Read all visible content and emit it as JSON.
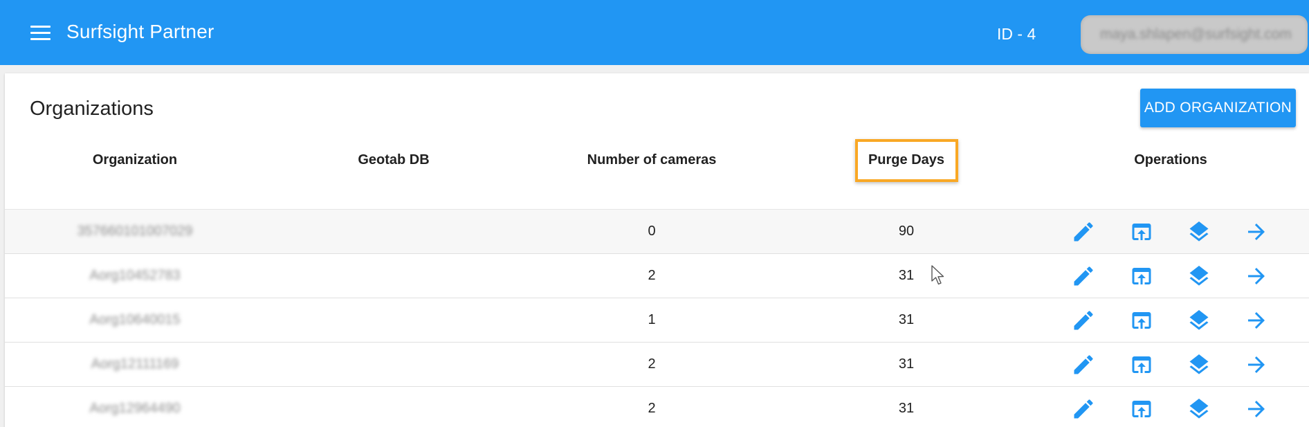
{
  "app": {
    "title": "Surfsight Partner",
    "id_label": "ID - 4",
    "user_email": "maya.shlapen@surfsight.com",
    "primary_color": "#2196f3",
    "highlight_color": "#f9a825"
  },
  "page": {
    "title": "Organizations",
    "add_button_label": "ADD ORGANIZATION"
  },
  "table": {
    "columns": {
      "organization": "Organization",
      "geotab_db": "Geotab DB",
      "number_of_cameras": "Number of cameras",
      "purge_days": "Purge Days",
      "operations": "Operations"
    },
    "highlighted_column": "purge_days",
    "rows": [
      {
        "organization": "357660101007029",
        "geotab_db": "",
        "number_of_cameras": "0",
        "purge_days": "90"
      },
      {
        "organization": "Aorg10452783",
        "geotab_db": "",
        "number_of_cameras": "2",
        "purge_days": "31"
      },
      {
        "organization": "Aorg10640015",
        "geotab_db": "",
        "number_of_cameras": "1",
        "purge_days": "31"
      },
      {
        "organization": "Aorg12111169",
        "geotab_db": "",
        "number_of_cameras": "2",
        "purge_days": "31"
      },
      {
        "organization": "Aorg12964490",
        "geotab_db": "",
        "number_of_cameras": "2",
        "purge_days": "31"
      }
    ],
    "operation_icons": [
      "pencil-icon",
      "open-in-browser-icon",
      "layers-icon",
      "arrow-forward-icon"
    ]
  }
}
